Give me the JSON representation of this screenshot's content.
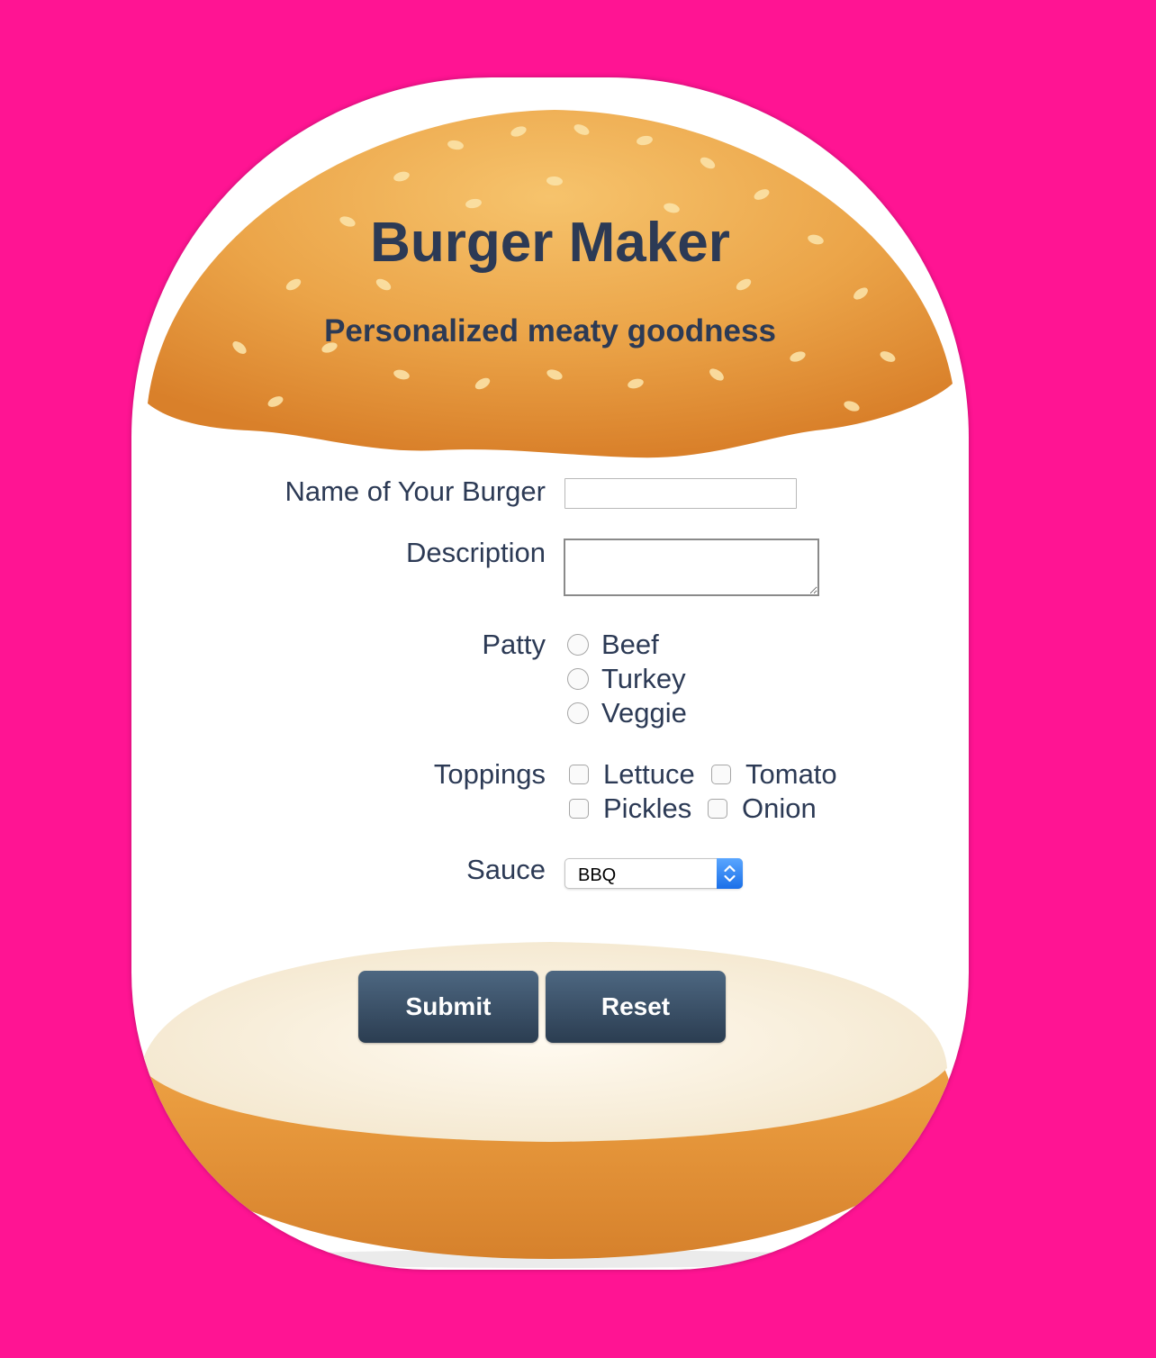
{
  "header": {
    "title": "Burger Maker",
    "subtitle": "Personalized meaty goodness"
  },
  "form": {
    "name_label": "Name of Your Burger",
    "name_value": "",
    "description_label": "Description",
    "description_value": "",
    "patty_label": "Patty",
    "patty_options": [
      "Beef",
      "Turkey",
      "Veggie"
    ],
    "toppings_label": "Toppings",
    "toppings_options": [
      "Lettuce",
      "Tomato",
      "Pickles",
      "Onion"
    ],
    "sauce_label": "Sauce",
    "sauce_selected": "BBQ",
    "submit_label": "Submit",
    "reset_label": "Reset"
  },
  "colors": {
    "background": "#ff1493",
    "text": "#2c3a55",
    "button": "#3b5168",
    "bun": "#e8962e"
  }
}
